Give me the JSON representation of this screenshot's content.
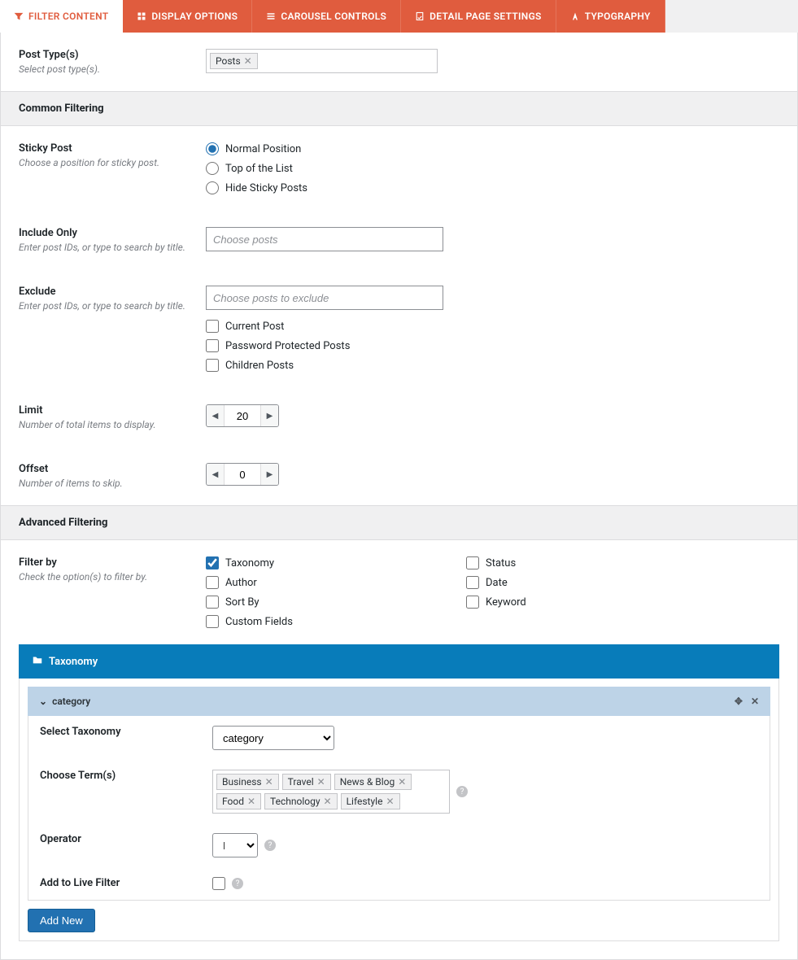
{
  "tabs": [
    {
      "label": "FILTER CONTENT",
      "active": true
    },
    {
      "label": "DISPLAY OPTIONS",
      "active": false
    },
    {
      "label": "CAROUSEL CONTROLS",
      "active": false
    },
    {
      "label": "DETAIL PAGE SETTINGS",
      "active": false
    },
    {
      "label": "TYPOGRAPHY",
      "active": false
    }
  ],
  "post_type": {
    "title": "Post Type(s)",
    "desc": "Select post type(s).",
    "tags": [
      "Posts"
    ]
  },
  "sections": {
    "common_filtering": "Common Filtering",
    "advanced_filtering": "Advanced Filtering"
  },
  "sticky": {
    "title": "Sticky Post",
    "desc": "Choose a position for sticky post.",
    "options": [
      "Normal Position",
      "Top of the List",
      "Hide Sticky Posts"
    ],
    "selected": "Normal Position"
  },
  "include": {
    "title": "Include Only",
    "desc": "Enter post IDs, or type to search by title.",
    "placeholder": "Choose posts"
  },
  "exclude": {
    "title": "Exclude",
    "desc": "Enter post IDs, or type to search by title.",
    "placeholder": "Choose posts to exclude",
    "checks": [
      "Current Post",
      "Password Protected Posts",
      "Children Posts"
    ]
  },
  "limit": {
    "title": "Limit",
    "desc": "Number of total items to display.",
    "value": "20"
  },
  "offset": {
    "title": "Offset",
    "desc": "Number of items to skip.",
    "value": "0"
  },
  "filter_by": {
    "title": "Filter by",
    "desc": "Check the option(s) to filter by.",
    "col1": [
      {
        "label": "Taxonomy",
        "checked": true
      },
      {
        "label": "Author",
        "checked": false
      },
      {
        "label": "Sort By",
        "checked": false
      },
      {
        "label": "Custom Fields",
        "checked": false
      }
    ],
    "col2": [
      {
        "label": "Status",
        "checked": false
      },
      {
        "label": "Date",
        "checked": false
      },
      {
        "label": "Keyword",
        "checked": false
      }
    ]
  },
  "taxonomy_bar": "Taxonomy",
  "tax_item": {
    "header": "category",
    "select_taxonomy_label": "Select Taxonomy",
    "select_taxonomy_value": "category",
    "choose_terms_label": "Choose Term(s)",
    "terms": [
      "Business",
      "Travel",
      "News & Blog",
      "Food",
      "Technology",
      "Lifestyle"
    ],
    "operator_label": "Operator",
    "operator_value": "IN",
    "live_filter_label": "Add to Live Filter"
  },
  "add_new": "Add New"
}
